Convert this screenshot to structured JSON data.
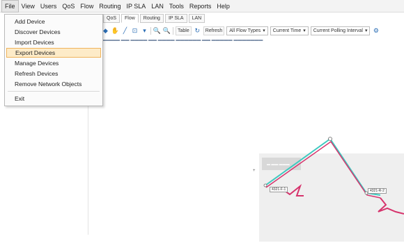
{
  "menubar": {
    "items": [
      "File",
      "View",
      "Users",
      "QoS",
      "Flow",
      "Routing",
      "IP SLA",
      "LAN",
      "Tools",
      "Reports",
      "Help"
    ]
  },
  "file_menu": {
    "items": [
      "Add Device",
      "Discover Devices",
      "Import Devices",
      "Export Devices",
      "Manage Devices",
      "Refresh Devices",
      "Remove Network Objects"
    ],
    "exit": "Exit",
    "highlighted": "Export Devices"
  },
  "tabs": [
    "QoS",
    "Flow",
    "Routing",
    "IP SLA",
    "LAN"
  ],
  "toolbar": {
    "table_label": "Table",
    "refresh_label": "Refresh",
    "flow_types": "All Flow Types",
    "time": "Current Time",
    "polling": "Current Polling Interval"
  },
  "map": {
    "node_labels": [
      "4321-F-1",
      "4321-R-2"
    ],
    "colors": {
      "link_cyan": "#3fc9c0",
      "link_red": "#d6336c",
      "grey_box": "#d8d8d8"
    }
  }
}
